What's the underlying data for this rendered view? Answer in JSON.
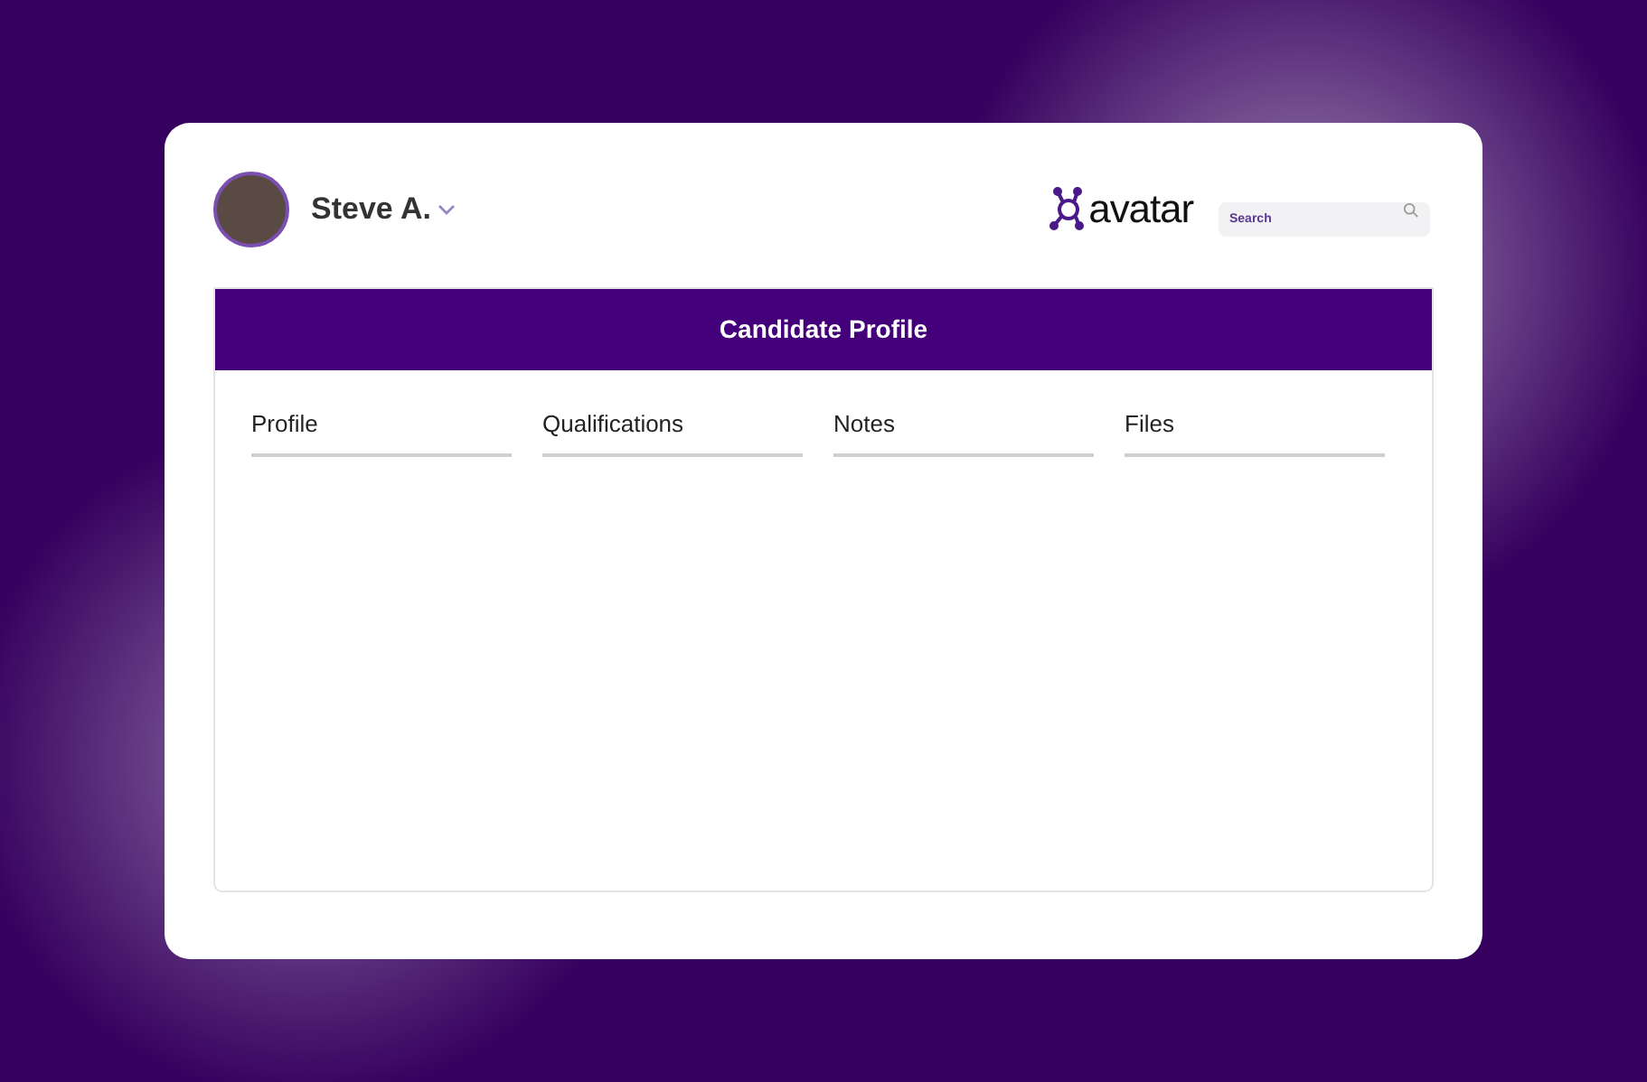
{
  "user": {
    "name": "Steve A."
  },
  "logo": {
    "text": "avatar"
  },
  "search": {
    "placeholder": "Search"
  },
  "panel": {
    "title": "Candidate Profile"
  },
  "tabs": [
    {
      "label": "Profile"
    },
    {
      "label": "Qualifications"
    },
    {
      "label": "Notes"
    },
    {
      "label": "Files"
    }
  ]
}
